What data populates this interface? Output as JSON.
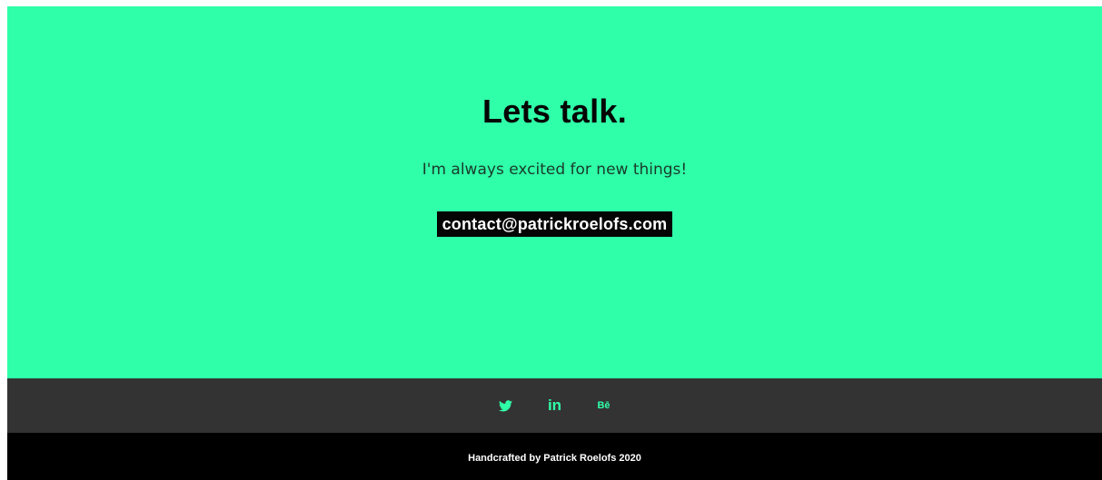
{
  "hero": {
    "title": "Lets talk.",
    "subtitle": "I'm always excited for new things!",
    "email": "contact@patrickroelofs.com"
  },
  "social": {
    "icons": [
      "twitter-icon",
      "linkedin-icon",
      "behance-icon"
    ],
    "linkedin_glyph": "in",
    "behance_glyph": "Bē"
  },
  "footer": {
    "credit": "Handcrafted by Patrick Roelofs 2020"
  },
  "colors": {
    "accent": "#2fffa8",
    "social_bar": "#333333",
    "footer_bg": "#000000",
    "text_dark": "#050505"
  }
}
